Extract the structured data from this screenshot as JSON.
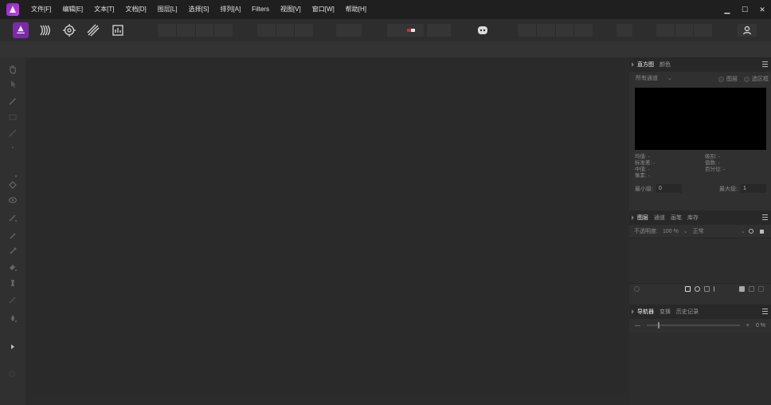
{
  "menu": {
    "items": [
      "文件[F]",
      "编辑[E]",
      "文本[T]",
      "文档[D]",
      "图层[L]",
      "选择[S]",
      "排列[A]",
      "Filters",
      "视图[V]",
      "窗口[W]",
      "帮助[H]"
    ]
  },
  "window": {
    "minimize": "▁",
    "maximize": "☐",
    "close": "✕"
  },
  "icons": {
    "app": "affinity-photo-logo-icon",
    "personas": [
      "photo-persona-icon",
      "liquify-persona-icon",
      "develop-persona-icon",
      "tone-mapping-persona-icon",
      "export-persona-icon"
    ],
    "assistant": "assistant-icon",
    "account": "account-icon"
  },
  "colors": {
    "accent": "#7b2aa8",
    "menubar": "#1f1f1f",
    "panel": "#303030",
    "canvas": "#2a2a2a",
    "histogram": "#000000"
  },
  "histogram_panel": {
    "tabs": [
      "直方图",
      "颜色"
    ],
    "active_tab": "直方图",
    "channel_select": "所有通道",
    "checkbox_1": "图层",
    "checkbox_2": "选区框",
    "stats_left": [
      "均值: -",
      "标准差: -",
      "中值: -",
      "像素: -"
    ],
    "stats_right": [
      "级别: -",
      "值数: -",
      "百分位: -"
    ],
    "min_label": "最小级:",
    "min_value": "0",
    "max_label": "最大级:",
    "max_value": "1"
  },
  "layers_panel": {
    "tabs": [
      "图层",
      "通道",
      "画笔",
      "库存"
    ],
    "active_tab": "图层",
    "opacity_label": "不透明度:",
    "opacity_value": "100 %",
    "blend_mode": "正常"
  },
  "navigator_panel": {
    "tabs": [
      "导航器",
      "变换",
      "历史记录"
    ],
    "active_tab": "导航器",
    "zoom_minus": "—",
    "zoom_plus": "+",
    "zoom_value": "0 %",
    "zoom_fraction": 0.02
  }
}
